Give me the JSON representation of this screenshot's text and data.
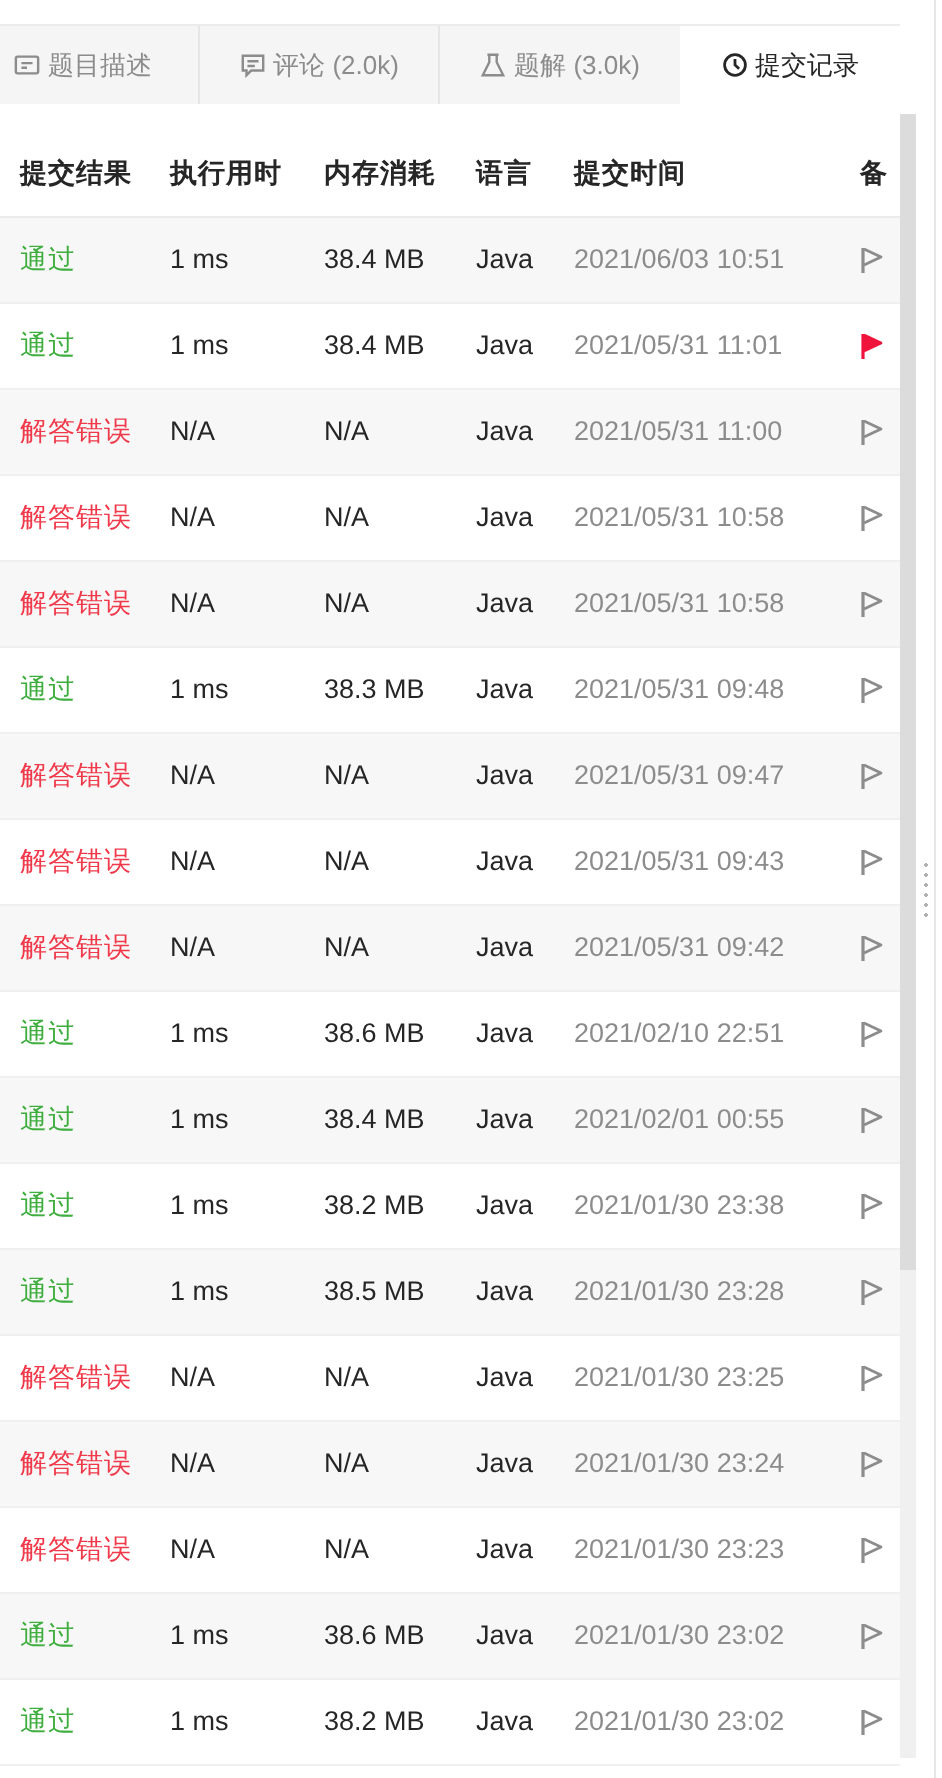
{
  "tabs": [
    {
      "label": "题目描述",
      "selected": false,
      "kind": "description"
    },
    {
      "label": "评论 (2.0k)",
      "selected": false,
      "kind": "comments"
    },
    {
      "label": "题解 (3.0k)",
      "selected": false,
      "kind": "solutions"
    },
    {
      "label": "提交记录",
      "selected": true,
      "kind": "submissions"
    }
  ],
  "table": {
    "columns": [
      "提交结果",
      "执行用时",
      "内存消耗",
      "语言",
      "提交时间",
      "备"
    ],
    "rows": [
      {
        "result": "通过",
        "kind": "accepted",
        "time": "1 ms",
        "memory": "38.4 MB",
        "language": "Java",
        "submitted": "2021/06/03 10:51",
        "flagged": false
      },
      {
        "result": "通过",
        "kind": "accepted",
        "time": "1 ms",
        "memory": "38.4 MB",
        "language": "Java",
        "submitted": "2021/05/31 11:01",
        "flagged": true
      },
      {
        "result": "解答错误",
        "kind": "wrong",
        "time": "N/A",
        "memory": "N/A",
        "language": "Java",
        "submitted": "2021/05/31 11:00",
        "flagged": false
      },
      {
        "result": "解答错误",
        "kind": "wrong",
        "time": "N/A",
        "memory": "N/A",
        "language": "Java",
        "submitted": "2021/05/31 10:58",
        "flagged": false
      },
      {
        "result": "解答错误",
        "kind": "wrong",
        "time": "N/A",
        "memory": "N/A",
        "language": "Java",
        "submitted": "2021/05/31 10:58",
        "flagged": false
      },
      {
        "result": "通过",
        "kind": "accepted",
        "time": "1 ms",
        "memory": "38.3 MB",
        "language": "Java",
        "submitted": "2021/05/31 09:48",
        "flagged": false
      },
      {
        "result": "解答错误",
        "kind": "wrong",
        "time": "N/A",
        "memory": "N/A",
        "language": "Java",
        "submitted": "2021/05/31 09:47",
        "flagged": false
      },
      {
        "result": "解答错误",
        "kind": "wrong",
        "time": "N/A",
        "memory": "N/A",
        "language": "Java",
        "submitted": "2021/05/31 09:43",
        "flagged": false
      },
      {
        "result": "解答错误",
        "kind": "wrong",
        "time": "N/A",
        "memory": "N/A",
        "language": "Java",
        "submitted": "2021/05/31 09:42",
        "flagged": false
      },
      {
        "result": "通过",
        "kind": "accepted",
        "time": "1 ms",
        "memory": "38.6 MB",
        "language": "Java",
        "submitted": "2021/02/10 22:51",
        "flagged": false
      },
      {
        "result": "通过",
        "kind": "accepted",
        "time": "1 ms",
        "memory": "38.4 MB",
        "language": "Java",
        "submitted": "2021/02/01 00:55",
        "flagged": false
      },
      {
        "result": "通过",
        "kind": "accepted",
        "time": "1 ms",
        "memory": "38.2 MB",
        "language": "Java",
        "submitted": "2021/01/30 23:38",
        "flagged": false
      },
      {
        "result": "通过",
        "kind": "accepted",
        "time": "1 ms",
        "memory": "38.5 MB",
        "language": "Java",
        "submitted": "2021/01/30 23:28",
        "flagged": false
      },
      {
        "result": "解答错误",
        "kind": "wrong",
        "time": "N/A",
        "memory": "N/A",
        "language": "Java",
        "submitted": "2021/01/30 23:25",
        "flagged": false
      },
      {
        "result": "解答错误",
        "kind": "wrong",
        "time": "N/A",
        "memory": "N/A",
        "language": "Java",
        "submitted": "2021/01/30 23:24",
        "flagged": false
      },
      {
        "result": "解答错误",
        "kind": "wrong",
        "time": "N/A",
        "memory": "N/A",
        "language": "Java",
        "submitted": "2021/01/30 23:23",
        "flagged": false
      },
      {
        "result": "通过",
        "kind": "accepted",
        "time": "1 ms",
        "memory": "38.6 MB",
        "language": "Java",
        "submitted": "2021/01/30 23:02",
        "flagged": false
      },
      {
        "result": "通过",
        "kind": "accepted",
        "time": "1 ms",
        "memory": "38.2 MB",
        "language": "Java",
        "submitted": "2021/01/30 23:02",
        "flagged": false
      }
    ]
  }
}
